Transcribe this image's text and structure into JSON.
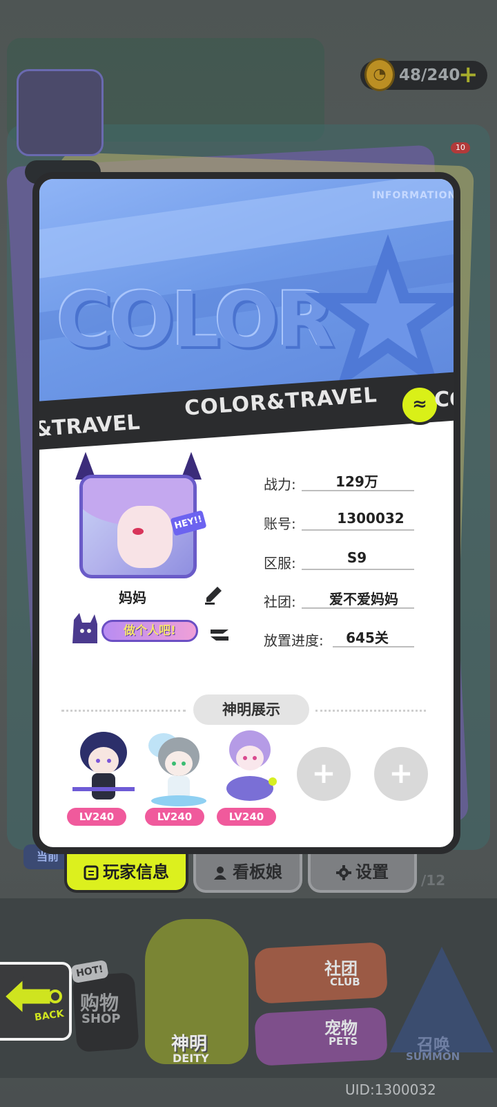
{
  "top_bar": {
    "stamina": "48/240",
    "stamina_plus": "+"
  },
  "background": {
    "notification_count": "10",
    "side_tab": "当前",
    "side_counter": "/12"
  },
  "card": {
    "banner_tag": "INFORMATION",
    "banner_logo": "COLOR",
    "strip_text": "COLOR&TRAVEL",
    "strip_text_left": "&TRAVEL",
    "strip_co": "CO",
    "player_name": "妈妈",
    "tagline_badge": "做个人吧!",
    "avatar_badge": "HEY!!",
    "info": [
      {
        "label": "战力:",
        "value": "129万"
      },
      {
        "label": "账号:",
        "value": "1300032"
      },
      {
        "label": "区服:",
        "value": "S9"
      },
      {
        "label": "社团:",
        "value": "爱不爱妈妈"
      },
      {
        "label": "放置进度:",
        "value": "645关"
      }
    ],
    "deity_section_title": "神明展示",
    "deities": [
      {
        "level": "LV240"
      },
      {
        "level": "LV240"
      },
      {
        "level": "LV240"
      }
    ],
    "empty_slots": [
      "+",
      "+"
    ]
  },
  "tabs": [
    {
      "label": "玩家信息",
      "active": true,
      "icon": "info-icon"
    },
    {
      "label": "看板娘",
      "active": false,
      "icon": "person-icon"
    },
    {
      "label": "设置",
      "active": false,
      "icon": "gear-icon"
    }
  ],
  "bottom_nav": {
    "back": "BACK",
    "hot": "HOT!",
    "shop_main": "购物",
    "shop_sub": "SHOP",
    "deity_main": "神明",
    "deity_sub": "DEITY",
    "club_main": "社团",
    "club_sub": "CLUB",
    "pets_main": "宠物",
    "pets_sub": "PETS",
    "summon_main": "召唤",
    "summon_sub": "SUMMON"
  },
  "footer": {
    "uid": "UID:1300032"
  },
  "colors": {
    "accent": "#DCF01E",
    "level_badge": "#F05A9C",
    "banner_blue": "#6F9AE8"
  }
}
